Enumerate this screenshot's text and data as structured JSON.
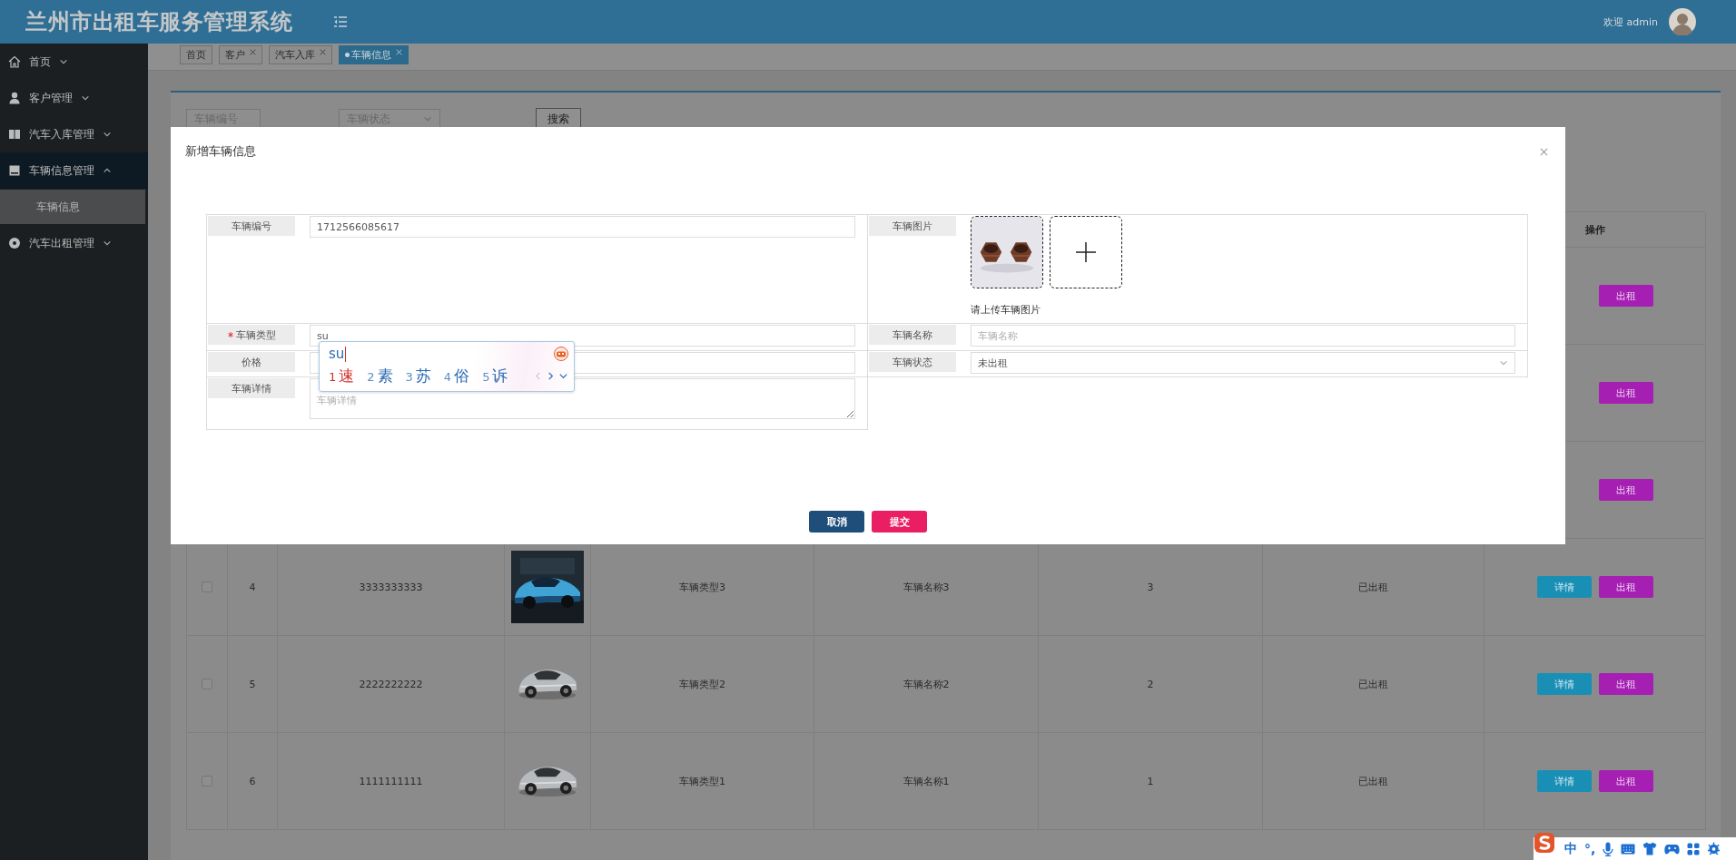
{
  "header": {
    "title": "兰州市出租车服务管理系统",
    "welcome": "欢迎 admin"
  },
  "sidebar": {
    "items": [
      {
        "label": "首页",
        "expanded": false
      },
      {
        "label": "客户管理",
        "expanded": false
      },
      {
        "label": "汽车入库管理",
        "expanded": false
      },
      {
        "label": "车辆信息管理",
        "expanded": true,
        "children": [
          {
            "label": "车辆信息",
            "selected": true
          }
        ]
      },
      {
        "label": "汽车出租管理",
        "expanded": false
      }
    ]
  },
  "tabs": [
    {
      "label": "首页",
      "closable": false,
      "selected": false
    },
    {
      "label": "客户",
      "closable": true,
      "selected": false
    },
    {
      "label": "汽车入库",
      "closable": true,
      "selected": false
    },
    {
      "label": "车辆信息",
      "closable": true,
      "selected": true
    }
  ],
  "search": {
    "fields": [
      {
        "kind": "input",
        "placeholder": "车辆编号"
      },
      {
        "kind": "select",
        "placeholder": "车辆状态"
      }
    ],
    "button": "搜索"
  },
  "table": {
    "action_heading": "操作",
    "rows": [
      {
        "actions": [
          {
            "label": "出租",
            "kind": "rent"
          }
        ]
      },
      {
        "actions": [
          {
            "label": "出租",
            "kind": "rent"
          }
        ]
      },
      {
        "actions": [
          {
            "label": "出租",
            "kind": "rent"
          }
        ]
      },
      {
        "checked": false,
        "index": "4",
        "number": "3333333333",
        "image": {
          "kind": "picture"
        },
        "type": "车辆类型3",
        "name": "车辆名称3",
        "price": "3",
        "status": "已出租",
        "actions": [
          {
            "label": "详情",
            "kind": "detail"
          },
          {
            "label": "出租",
            "kind": "rent"
          }
        ]
      },
      {
        "checked": false,
        "index": "5",
        "number": "2222222222",
        "image": {
          "kind": "picture"
        },
        "type": "车辆类型2",
        "name": "车辆名称2",
        "price": "2",
        "status": "已出租",
        "actions": [
          {
            "label": "详情",
            "kind": "detail"
          },
          {
            "label": "出租",
            "kind": "rent"
          }
        ]
      },
      {
        "checked": false,
        "index": "6",
        "number": "1111111111",
        "image": {
          "kind": "picture"
        },
        "type": "车辆类型1",
        "name": "车辆名称1",
        "price": "1",
        "status": "已出租",
        "actions": [
          {
            "label": "详情",
            "kind": "detail"
          },
          {
            "label": "出租",
            "kind": "rent"
          }
        ]
      }
    ]
  },
  "dialog": {
    "title": "新增车辆信息",
    "left": [
      {
        "label": "车辆编号",
        "kind": "input",
        "required": false,
        "value": "1712566085617"
      },
      {
        "label": "车辆类型",
        "kind": "input",
        "required": true,
        "value": "su"
      },
      {
        "label": "价格",
        "kind": "input",
        "required": false
      },
      {
        "label": "车辆详情",
        "kind": "textarea",
        "required": false,
        "placeholder": "车辆详情"
      }
    ],
    "right": [
      {
        "label": "车辆图片",
        "kind": "upload",
        "required": false,
        "hint": "请上传车辆图片",
        "image": {
          "kind": "picture"
        }
      },
      {
        "label": "车辆名称",
        "kind": "input",
        "required": false,
        "placeholder": "车辆名称"
      },
      {
        "label": "车辆状态",
        "kind": "select",
        "required": false,
        "value": "未出租"
      }
    ],
    "buttons": [
      {
        "label": "取消",
        "kind": "cancel"
      },
      {
        "label": "提交",
        "kind": "submit"
      }
    ]
  },
  "ime": {
    "composition": "su",
    "candidates": [
      {
        "index": "1",
        "text": "速",
        "selected": true
      },
      {
        "index": "2",
        "text": "素",
        "selected": false
      },
      {
        "index": "3",
        "text": "苏",
        "selected": false
      },
      {
        "index": "4",
        "text": "俗",
        "selected": false
      },
      {
        "index": "5",
        "text": "诉",
        "selected": false
      }
    ]
  },
  "ime_bar": {
    "items": [
      {
        "kind": "logo"
      },
      {
        "kind": "text",
        "text": "中"
      },
      {
        "kind": "text",
        "text": "°,"
      },
      {
        "kind": "mic"
      },
      {
        "kind": "keyboard"
      },
      {
        "kind": "shirt"
      },
      {
        "kind": "gamepad"
      },
      {
        "kind": "grid"
      },
      {
        "kind": "gear"
      }
    ]
  }
}
